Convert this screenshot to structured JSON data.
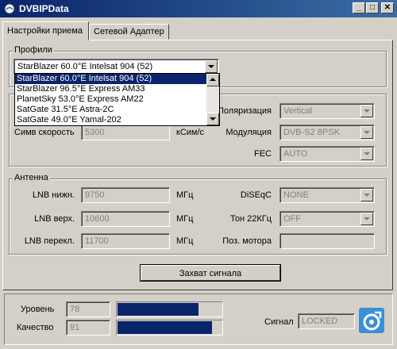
{
  "window": {
    "title": "DVBIPData",
    "min_glyph": "_",
    "max_glyph": "□",
    "close_glyph": "✕"
  },
  "tabs": [
    {
      "label": "Настройки приема",
      "active": true
    },
    {
      "label": "Сетевой Адаптер",
      "active": false
    }
  ],
  "profiles": {
    "legend": "Профили",
    "selected": "StarBlazer 60.0°E Intelsat 904 (52)",
    "options": [
      "StarBlazer 60.0°E Intelsat 904 (52)",
      "StarBlazer 96.5°E Express AM33",
      "PlanetSky 53.0°E Express AM22",
      "SatGate 31.5°E Astra-2C",
      "SatGate 49.0°E Yamal-202"
    ]
  },
  "signal_params": {
    "symbol_rate_label": "Симв скорость",
    "symbol_rate_value": "5300",
    "symbol_rate_unit": "кСим/с",
    "polarization_label": "Поляризация",
    "polarization_value": "Vertical",
    "modulation_label": "Модуляция",
    "modulation_value": "DVB-S2 8PSK",
    "fec_label": "FEC",
    "fec_value": "AUTO"
  },
  "antenna": {
    "legend": "Антенна",
    "lnb_low_label": "LNB нижн.",
    "lnb_low_value": "9750",
    "lnb_high_label": "LNB верх.",
    "lnb_high_value": "10600",
    "lnb_switch_label": "LNB перекл.",
    "lnb_switch_value": "11700",
    "unit_mhz": "МГц",
    "diseqc_label": "DiSEqC",
    "diseqc_value": "NONE",
    "tone_label": "Тон 22КГц",
    "tone_value": "OFF",
    "motor_label": "Поз. мотора",
    "motor_value": ""
  },
  "capture_button_label": "Захват сигнала",
  "status": {
    "level_label": "Уровень",
    "level_value": "78",
    "level_fraction": 0.78,
    "quality_label": "Качество",
    "quality_value": "91",
    "quality_fraction": 0.91,
    "signal_label": "Сигнал",
    "signal_value": "LOCKED"
  },
  "colors": {
    "titlebar": "#0a246a",
    "bar_fill": "#0a246a",
    "logo": "#3b8fd6"
  }
}
